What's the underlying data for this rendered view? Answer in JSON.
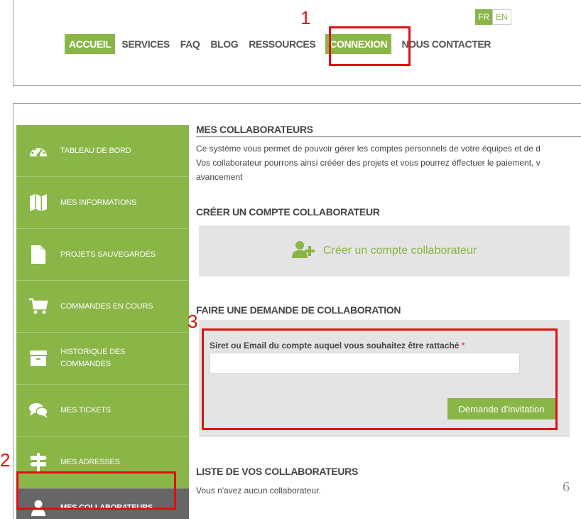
{
  "header": {
    "nav": [
      "ACCUEIL",
      "SERVICES",
      "FAQ",
      "BLOG",
      "RESSOURCES",
      "CONNEXION",
      "NOUS CONTACTER"
    ],
    "lang": {
      "fr": "FR",
      "en": "EN"
    }
  },
  "sidebar": {
    "items": [
      {
        "label": "TABLEAU DE BORD",
        "icon": "dashboard-icon"
      },
      {
        "label": "MES INFORMATIONS",
        "icon": "map-icon"
      },
      {
        "label": "PROJETS SAUVEGARDÉS",
        "icon": "document-icon"
      },
      {
        "label": "COMMANDES EN COURS",
        "icon": "cart-icon"
      },
      {
        "label": "HISTORIQUE DES COMMANDES",
        "icon": "archive-icon"
      },
      {
        "label": "MES TICKETS",
        "icon": "chat-icon"
      },
      {
        "label": "MES ADRESSES",
        "icon": "signpost-icon"
      },
      {
        "label": "MES COLLABORATEURS",
        "icon": "user-icon"
      }
    ]
  },
  "main": {
    "title": "MES COLLABORATEURS",
    "intro": [
      "Ce système vous permet de pouvoir gérer les comptes personnels de votre équipes et de d",
      "Vos collaborateur pourrons ainsi crééer des projets et vous pourrez éffectuer le paiement, v",
      "avancement"
    ],
    "create_heading": "CRÉER UN COMPTE COLLABORATEUR",
    "create_button": "Créer un compte collaborateur",
    "request_heading": "FAIRE UNE DEMANDE DE COLLABORATION",
    "request_label": "Siret ou Email du compte auquel vous souhaitez être rattaché",
    "request_required": "*",
    "request_value": "",
    "request_button": "Demande d'invitation",
    "list_heading": "LISTE DE VOS COLLABORATEURS",
    "empty": "Vous n'avez aucun collaborateur.",
    "page_number": "6"
  },
  "annotations": [
    "1",
    "2",
    "3"
  ],
  "colors": {
    "accent": "#8ab547",
    "active_sidebar": "#666666",
    "annotation": "#e01010",
    "panel_bg": "#e4e4e4"
  }
}
